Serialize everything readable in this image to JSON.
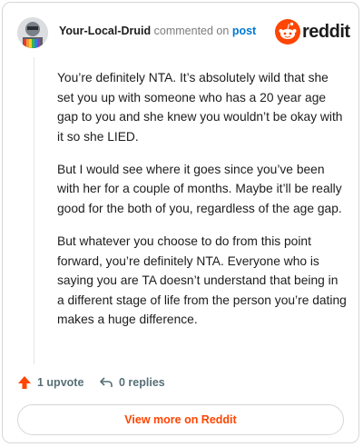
{
  "header": {
    "username": "Your-Local-Druid",
    "action_text": "commented on",
    "post_link": "post",
    "brand": "reddit"
  },
  "comment": {
    "paragraphs": [
      "You’re definitely NTA. It’s absolutely wild that she set you up with someone who has a 20 year age gap to you and she knew you wouldn’t be okay with it so she LIED.",
      "But I would see where it goes since you’ve been with her for a couple of months. Maybe it’ll be really good for the both of you, regardless of the age gap.",
      "But whatever you choose to do from this point forward, you’re definitely NTA. Everyone who is saying you are TA doesn’t understand that being in a different stage of life from the person you’re dating makes a huge difference."
    ]
  },
  "actions": {
    "upvote_label": "1 upvote",
    "replies_label": "0 replies"
  },
  "footer": {
    "view_more_label": "View more on Reddit"
  },
  "colors": {
    "brand_orange": "#ff4500",
    "link_blue": "#0079d3",
    "muted": "#576f76"
  },
  "icons": {
    "upvote": "upvote-arrow-icon",
    "reply": "reply-arrow-icon",
    "logo": "reddit-snoo-icon"
  }
}
